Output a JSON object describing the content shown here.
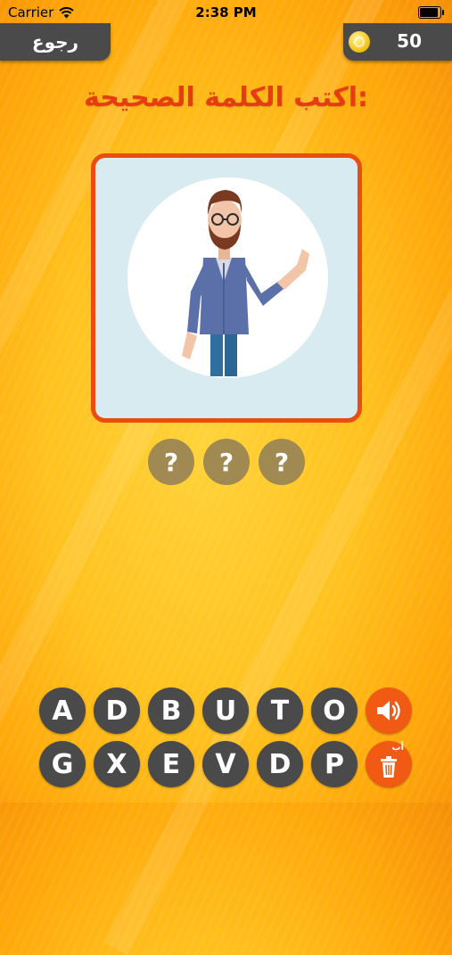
{
  "status_bar": {
    "carrier": "Carrier",
    "time": "2:38 PM",
    "battery_level": 1.0
  },
  "header": {
    "back_label": "رجوع",
    "coins": "50"
  },
  "title": "اكتب الكلمة الصحيحة:",
  "picture": {
    "icon": "man-with-glasses-waving-illustration"
  },
  "answer_slots": [
    "?",
    "?",
    "?"
  ],
  "keyboard": {
    "row1": [
      "A",
      "D",
      "B",
      "U",
      "T",
      "O"
    ],
    "row2": [
      "G",
      "X",
      "E",
      "V",
      "D",
      "P"
    ],
    "sound_icon": "speaker-icon",
    "clear_icon": "trash-icon",
    "clear_label": "أب"
  },
  "colors": {
    "title": "#e53d10",
    "frame": "#ea4d10",
    "dark_button": "#4a4a4a",
    "orange_button": "#f05a12",
    "slot": "#a08a52"
  }
}
